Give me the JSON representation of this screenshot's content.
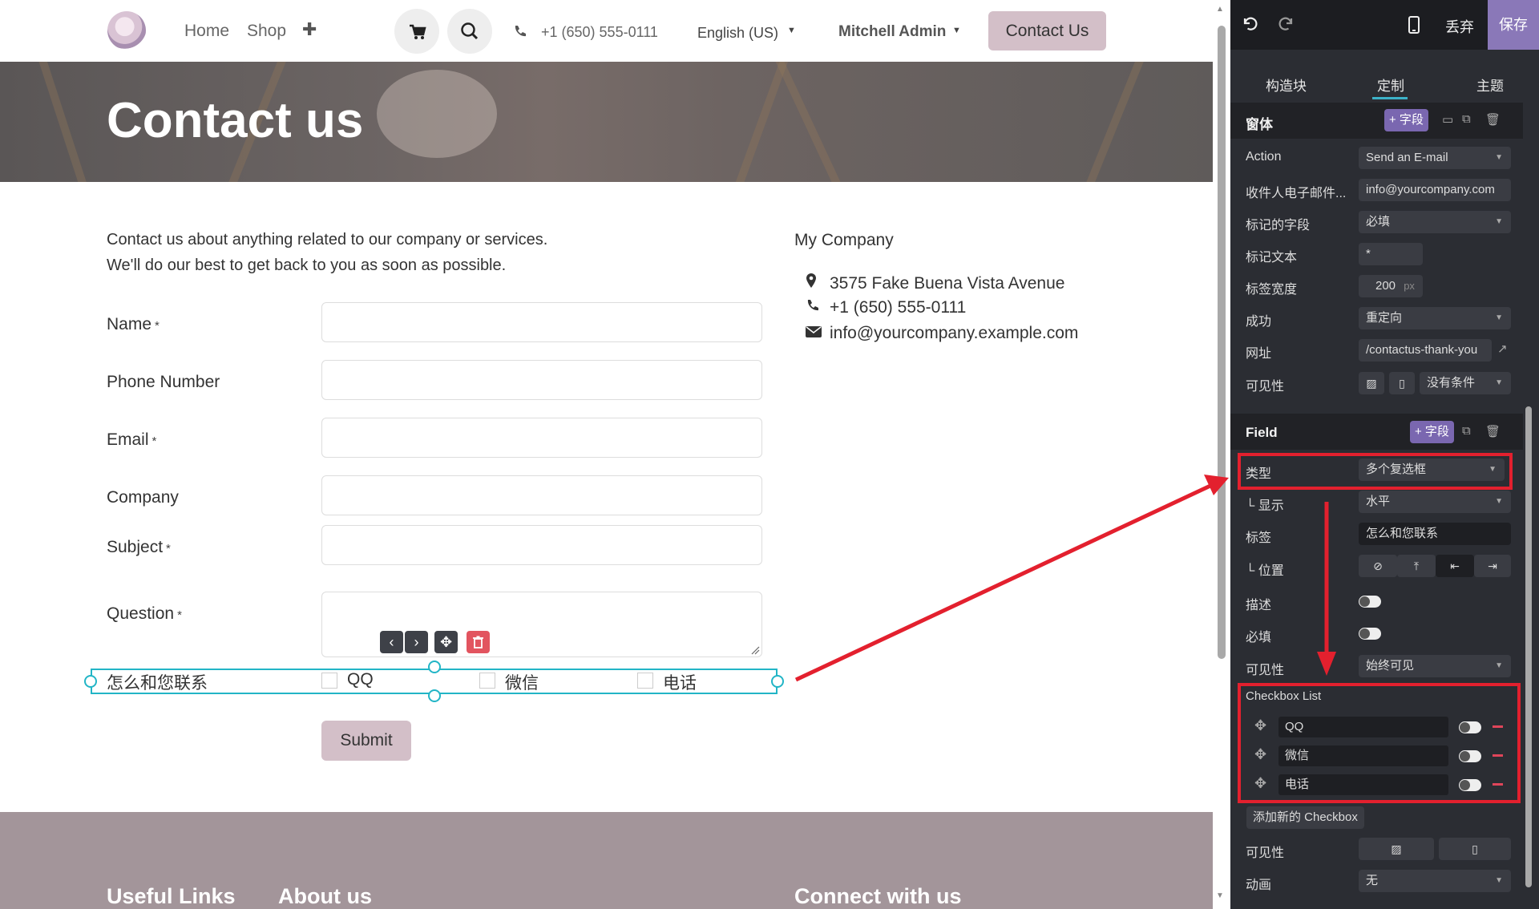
{
  "nav": {
    "home": "Home",
    "shop": "Shop",
    "plus": "✚",
    "phone": "+1 (650) 555-0111",
    "language": "English (US)",
    "user": "Mitchell Admin",
    "contact_btn": "Contact Us"
  },
  "banner": {
    "title": "Contact us"
  },
  "intro": {
    "line1": "Contact us about anything related to our company or services.",
    "line2": "We'll do our best to get back to you as soon as possible."
  },
  "form": {
    "req_mark": "*",
    "fields": [
      "Name",
      "Phone Number",
      "Email",
      "Company",
      "Subject",
      "Question"
    ],
    "checkbox_label": "怎么和您联系",
    "options": [
      "QQ",
      "微信",
      "电话"
    ],
    "submit": "Submit"
  },
  "company": {
    "name": "My Company",
    "address": "3575 Fake Buena Vista Avenue",
    "phone": "+1 (650) 555-0111",
    "email": "info@yourcompany.example.com"
  },
  "footer": {
    "h1": "Useful Links",
    "h2": "About us",
    "h3": "Connect with us"
  },
  "panel": {
    "discard": "丢弃",
    "save": "保存",
    "tabs": [
      "构造块",
      "定制",
      "主题"
    ],
    "form_section": {
      "title": "窗体",
      "add_field": "+ 字段",
      "rows": {
        "action_label": "Action",
        "action_value": "Send an E-mail",
        "recipient_label": "收件人电子邮件...",
        "recipient_value": "info@yourcompany.com",
        "marked_label": "标记的字段",
        "marked_value": "必填",
        "marktext_label": "标记文本",
        "marktext_value": "*",
        "labelwidth_label": "标签宽度",
        "labelwidth_value": "200",
        "labelwidth_unit": "px",
        "success_label": "成功",
        "success_value": "重定向",
        "url_label": "网址",
        "url_value": "/contactus-thank-you",
        "visibility_label": "可见性",
        "visibility_value": "没有条件"
      }
    },
    "field_section": {
      "title": "Field",
      "add_field": "+ 字段",
      "rows": {
        "type_label": "类型",
        "type_value": "多个复选框",
        "display_label": "└ 显示",
        "display_value": "水平",
        "label_label": "标签",
        "label_value": "怎么和您联系",
        "position_label": "└ 位置",
        "desc_label": "描述",
        "required_label": "必填",
        "visibility_label": "可见性",
        "visibility_value": "始终可见"
      },
      "checkbox_list_title": "Checkbox List",
      "checkbox_items": [
        "QQ",
        "微信",
        "电话"
      ],
      "add_checkbox": "添加新的 Checkbox",
      "visibility2_label": "可见性",
      "animation_label": "动画",
      "animation_value": "无"
    }
  },
  "colors": {
    "accent": "#22b5c6",
    "primary": "#d3bfc8",
    "panel": "#2b2d33",
    "annotation": "#e3202e",
    "purple": "#7a67b0"
  }
}
